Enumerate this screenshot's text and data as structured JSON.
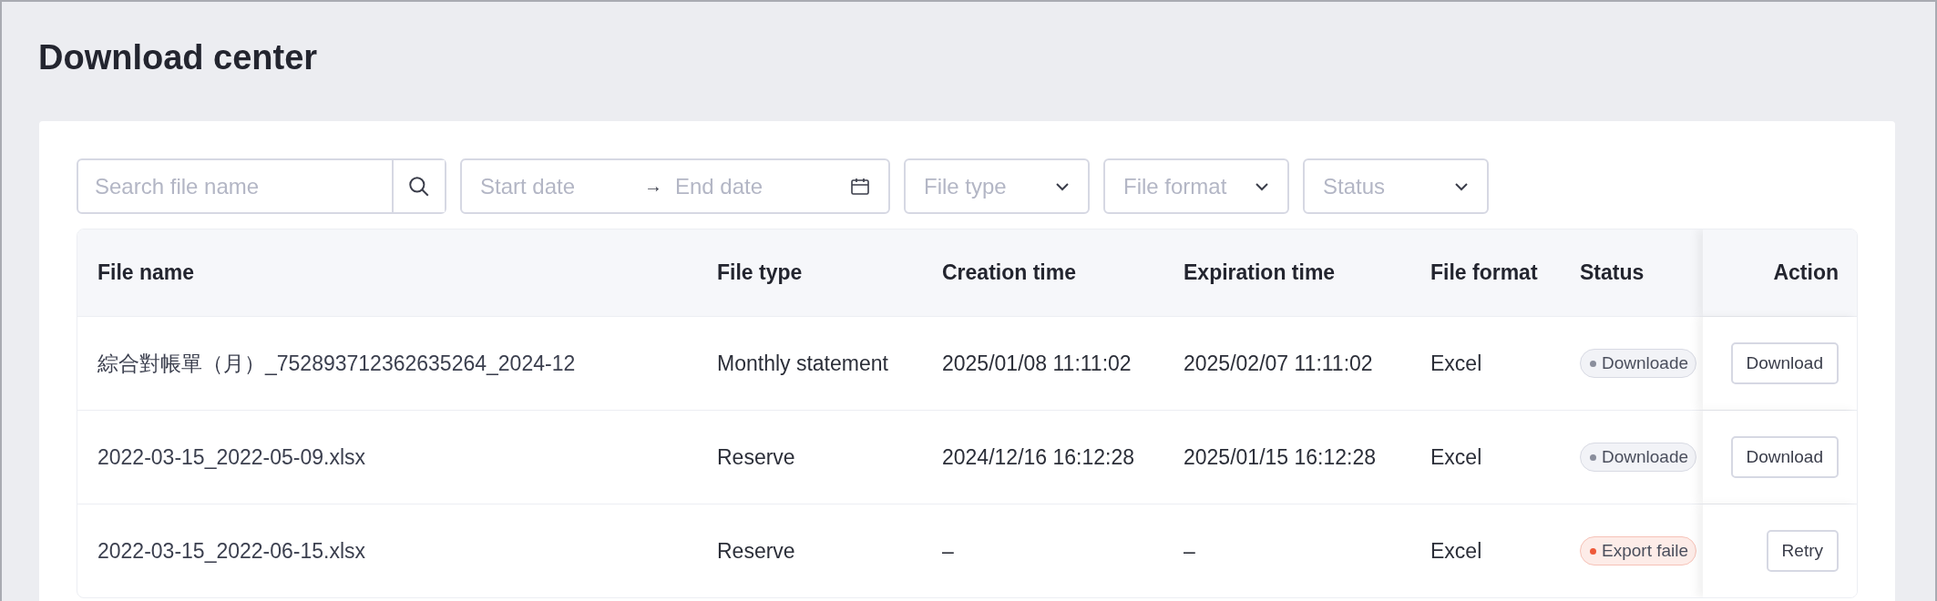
{
  "page": {
    "title": "Download center"
  },
  "filters": {
    "search": {
      "placeholder": "Search file name"
    },
    "date_range": {
      "start_placeholder": "Start date",
      "separator": "→",
      "end_placeholder": "End date"
    },
    "dropdowns": [
      {
        "placeholder": "File type"
      },
      {
        "placeholder": "File format"
      },
      {
        "placeholder": "Status"
      }
    ]
  },
  "table": {
    "columns": [
      "File name",
      "File type",
      "Creation time",
      "Expiration time",
      "File format",
      "Status",
      "Action"
    ],
    "rows": [
      {
        "file_name": "綜合對帳單（月）_752893712362635264_2024-12",
        "file_type": "Monthly statement",
        "creation_time": "2025/01/08 11:11:02",
        "expiration_time": "2025/02/07 11:11:02",
        "file_format": "Excel",
        "status": {
          "label": "Downloade",
          "kind": "neutral"
        },
        "action": {
          "label": "Download"
        }
      },
      {
        "file_name": "2022-03-15_2022-05-09.xlsx",
        "file_type": "Reserve",
        "creation_time": "2024/12/16 16:12:28",
        "expiration_time": "2025/01/15 16:12:28",
        "file_format": "Excel",
        "status": {
          "label": "Downloade",
          "kind": "neutral"
        },
        "action": {
          "label": "Download"
        }
      },
      {
        "file_name": "2022-03-15_2022-06-15.xlsx",
        "file_type": "Reserve",
        "creation_time": "–",
        "expiration_time": "–",
        "file_format": "Excel",
        "status": {
          "label": "Export faile",
          "kind": "error"
        },
        "action": {
          "label": "Retry"
        }
      }
    ]
  }
}
